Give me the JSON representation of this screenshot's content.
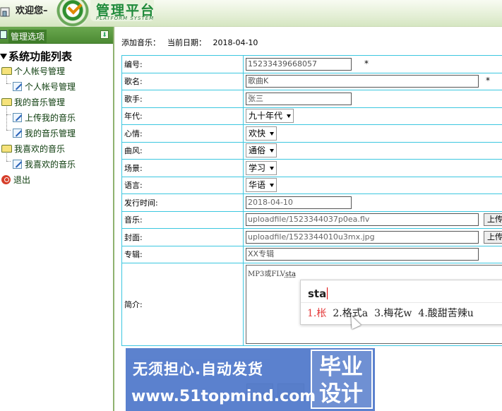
{
  "header": {
    "welcome": "欢迎您–",
    "brand": "管理平台",
    "brand_sub": "PLATFORM SYSTEM"
  },
  "sidebar": {
    "title": "管理选项",
    "collapse_glyph": "⬇",
    "root": "系统功能列表",
    "groups": [
      {
        "label": "个人帐号管理",
        "items": [
          "个人帐号管理"
        ]
      },
      {
        "label": "我的音乐管理",
        "items": [
          "上传我的音乐",
          "我的音乐管理"
        ]
      },
      {
        "label": "我喜欢的音乐",
        "items": [
          "我喜欢的音乐"
        ]
      }
    ],
    "exit": "退出"
  },
  "main": {
    "caption": "添加音乐：",
    "date_label": "当前日期：",
    "date_value": "2018-04-10"
  },
  "form": {
    "id": {
      "label": "编号:",
      "value": "15233439668057",
      "required": "*"
    },
    "song": {
      "label": "歌名:",
      "value": "歌曲K",
      "required": "*"
    },
    "singer": {
      "label": "歌手:",
      "value": "张三"
    },
    "era": {
      "label": "年代:",
      "value": "九十年代"
    },
    "mood": {
      "label": "心情:",
      "value": "欢快"
    },
    "style": {
      "label": "曲风:",
      "value": "通俗"
    },
    "scene": {
      "label": "场景:",
      "value": "学习"
    },
    "language": {
      "label": "语言:",
      "value": "华语"
    },
    "release": {
      "label": "发行时间:",
      "value": "2018-04-10"
    },
    "music": {
      "label": "音乐:",
      "value": "uploadfile/1523344037p0ea.flv",
      "button": "上传"
    },
    "cover": {
      "label": "封面:",
      "value": "uploadfile/1523344010u3mx.jpg",
      "button": "上传"
    },
    "album": {
      "label": "专辑:",
      "value": "XX专辑"
    },
    "intro": {
      "label": "简介:",
      "text": "MP3或FLV",
      "composing": "sta"
    }
  },
  "ime": {
    "pinyin": "sta",
    "candidates": [
      "1.枨",
      "2.格式a",
      "3.梅花w",
      "4.酸甜苦辣u"
    ]
  },
  "watermark": {
    "line1": "无须担心.自动发货",
    "line2": "www.51topmind.com",
    "box": "毕业\n设计"
  }
}
